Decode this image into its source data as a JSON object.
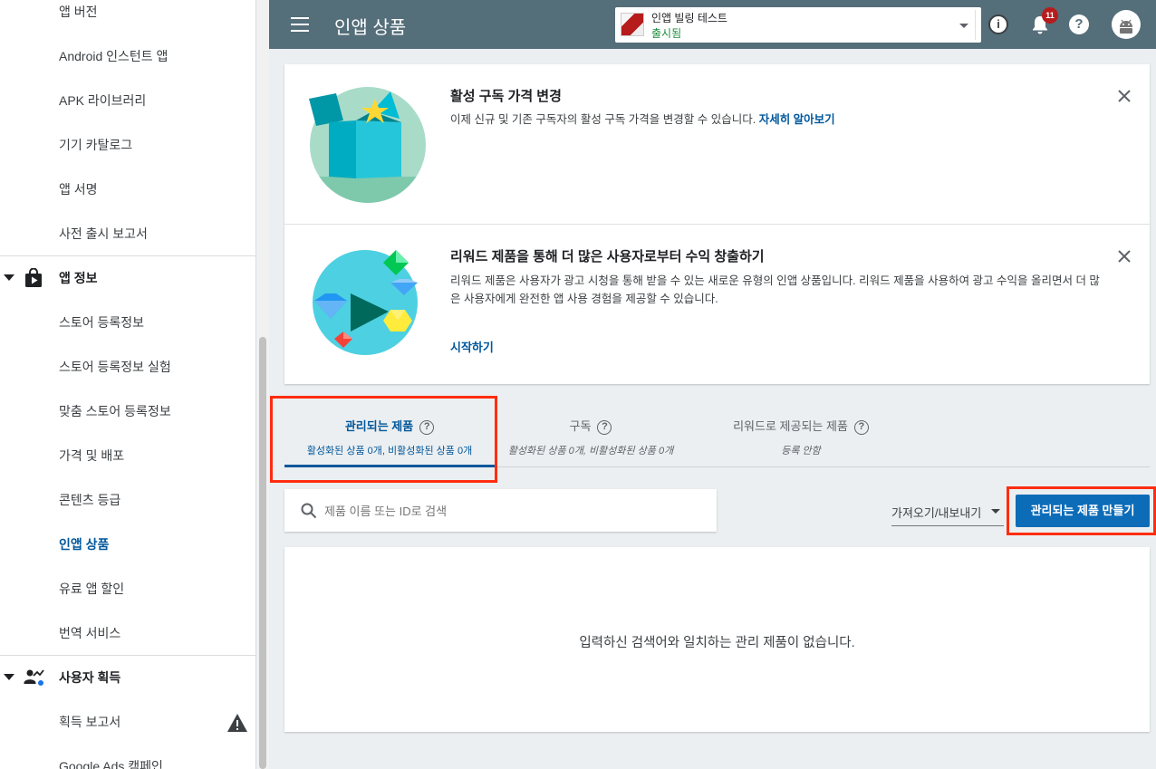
{
  "sidebar": {
    "items_top": [
      {
        "label": "앱 버전",
        "active": false
      },
      {
        "label": "Android 인스턴트 앱",
        "active": false
      },
      {
        "label": "APK 라이브러리",
        "active": false
      },
      {
        "label": "기기 카탈로그",
        "active": false
      },
      {
        "label": "앱 서명",
        "active": false
      },
      {
        "label": "사전 출시 보고서",
        "active": false
      }
    ],
    "section_app_info": {
      "label": "앱 정보",
      "icon": "store-bag-icon",
      "items": [
        {
          "label": "스토어 등록정보",
          "active": false
        },
        {
          "label": "스토어 등록정보 실험",
          "active": false
        },
        {
          "label": "맞춤 스토어 등록정보",
          "active": false
        },
        {
          "label": "가격 및 배포",
          "active": false
        },
        {
          "label": "콘텐츠 등급",
          "active": false
        },
        {
          "label": "인앱 상품",
          "active": true
        },
        {
          "label": "유료 앱 할인",
          "active": false
        },
        {
          "label": "번역 서비스",
          "active": false
        }
      ]
    },
    "section_user_acquisition": {
      "label": "사용자 획득",
      "icon": "user-acquisition-icon",
      "items": [
        {
          "label": "획득 보고서",
          "active": false,
          "badge_icon": "warning-icon"
        },
        {
          "label": "Google Ads 캠페인",
          "active": false
        }
      ]
    }
  },
  "topbar": {
    "menu_icon": "hamburger-menu-icon",
    "title": "인앱 상품",
    "app_selector": {
      "name": "인앱 빌링 테스트",
      "status": "출시됨"
    },
    "notification_count": "11",
    "info_glyph": "i",
    "help_glyph": "?"
  },
  "promos": [
    {
      "title": "활성 구독 가격 변경",
      "text": "이제 신규 및 기존 구독자의 활성 구독 가격을 변경할 수 있습니다.",
      "link": "자세히 알아보기"
    },
    {
      "title": "리워드 제품을 통해 더 많은 사용자로부터 수익 창출하기",
      "text": "리워드 제품은 사용자가 광고 시청을 통해 받을 수 있는 새로운 유형의 인앱 상품입니다. 리워드 제품을 사용하여 광고 수익을 올리면서 더 많은 사용자에게 완전한 앱 사용 경험을 제공할 수 있습니다.",
      "link": "시작하기"
    }
  ],
  "tabs": [
    {
      "label": "관리되는 제품",
      "sub": "활성화된 상품 0개, 비활성화된 상품 0개",
      "active": true
    },
    {
      "label": "구독",
      "sub": "활성화된 상품 0개, 비활성화된 상품 0개",
      "active": false
    },
    {
      "label": "리워드로 제공되는 제품",
      "sub": "등록 안함",
      "active": false
    }
  ],
  "search": {
    "placeholder": "제품 이름 또는 ID로 검색",
    "value": ""
  },
  "import_export_label": "가져오기/내보내기",
  "create_button_label": "관리되는 제품 만들기",
  "empty_message": "입력하신 검색어와 일치하는 관리 제품이 없습니다.",
  "colors": {
    "accent": "#01579b",
    "topbar": "#546e7a",
    "primary_button": "#0c6cb8",
    "highlight": "#ff2d10",
    "status_green": "#1e8e3e",
    "badge_red": "#b71c1c"
  }
}
